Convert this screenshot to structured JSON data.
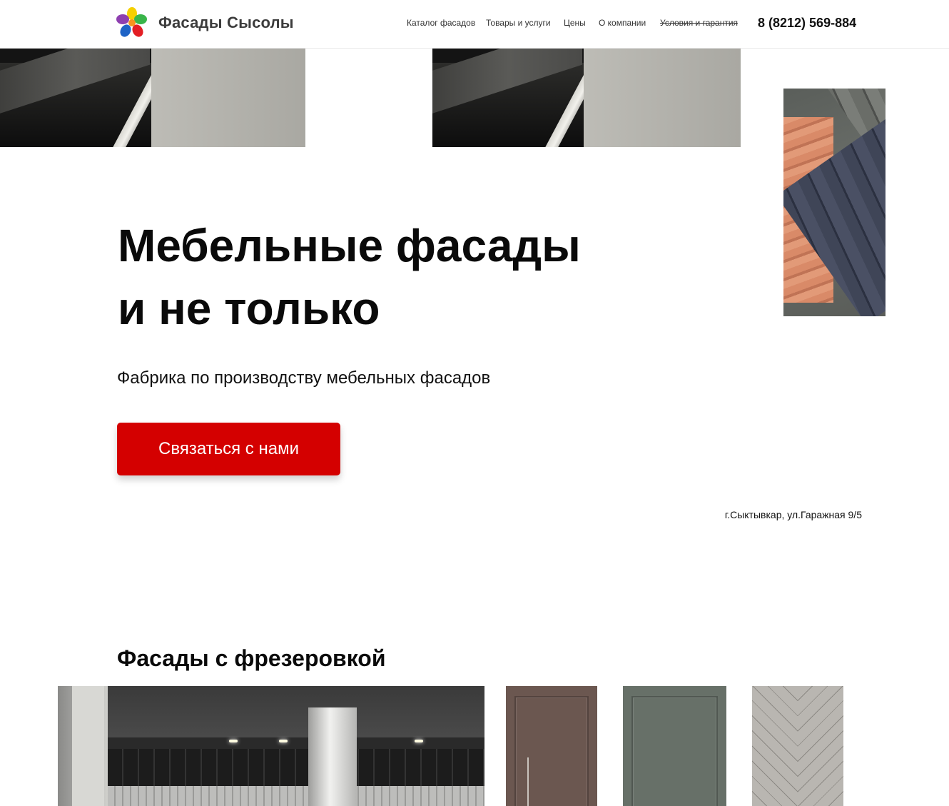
{
  "header": {
    "brand": "Фасады Сысолы",
    "nav": [
      {
        "label": "Каталог фасадов"
      },
      {
        "label": "Товары и услуги"
      },
      {
        "label": "Цены"
      },
      {
        "label": "О компании"
      },
      {
        "label": "Условия и гарантия"
      }
    ],
    "phone": "8 (8212) 569-884"
  },
  "hero": {
    "title_line1": "Мебельные фасады",
    "title_line2": "и не только",
    "subtitle": "Фабрика по производству мебельных фасадов",
    "cta_label": "Связаться с нами",
    "address": "г.Сыктывкар, ул.Гаражная 9/5"
  },
  "section": {
    "title": "Фасады с фрезеровкой"
  },
  "colors": {
    "accent": "#d40000",
    "text": "#111111",
    "brand_text": "#3c3c3c"
  }
}
